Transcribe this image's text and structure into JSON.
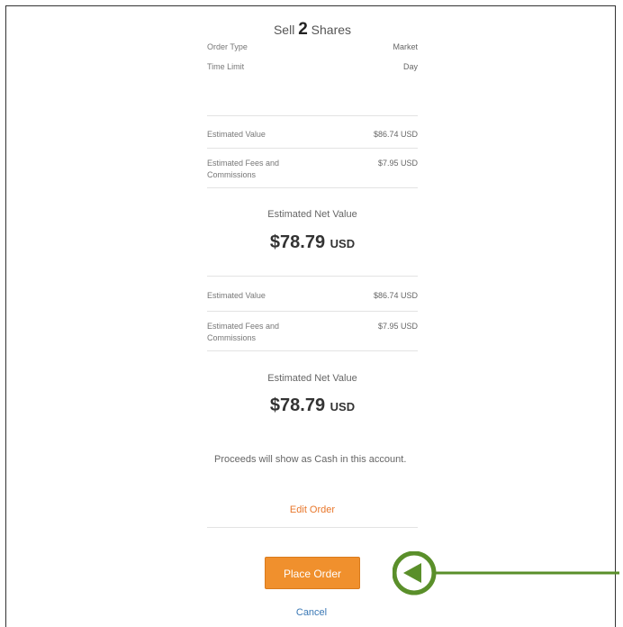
{
  "header": {
    "title_prefix": "Sell",
    "quantity": "2",
    "title_suffix": "Shares"
  },
  "order_details": [
    {
      "label": "Order Type",
      "value": "Market"
    },
    {
      "label": "Time Limit",
      "value": "Day"
    }
  ],
  "summary_blocks": [
    {
      "estimated_value_label": "Estimated Value",
      "estimated_value": "$86.74 USD",
      "fees_label_line1": "Estimated Fees and",
      "fees_label_line2": "Commissions",
      "fees_value": "$7.95 USD",
      "net_value_label": "Estimated Net Value",
      "net_value_amount": "$78.79",
      "net_value_currency": "USD"
    },
    {
      "estimated_value_label": "Estimated Value",
      "estimated_value": "$86.74 USD",
      "fees_label_line1": "Estimated Fees and",
      "fees_label_line2": "Commissions",
      "fees_value": "$7.95 USD",
      "net_value_label": "Estimated Net Value",
      "net_value_amount": "$78.79",
      "net_value_currency": "USD"
    }
  ],
  "proceeds_note": "Proceeds will show as Cash in this account.",
  "actions": {
    "edit_order": "Edit Order",
    "place_order": "Place Order",
    "cancel": "Cancel"
  },
  "colors": {
    "accent_orange": "#f0902d",
    "link_blue": "#3a78b5",
    "annotation_green": "#5a8f2a"
  }
}
